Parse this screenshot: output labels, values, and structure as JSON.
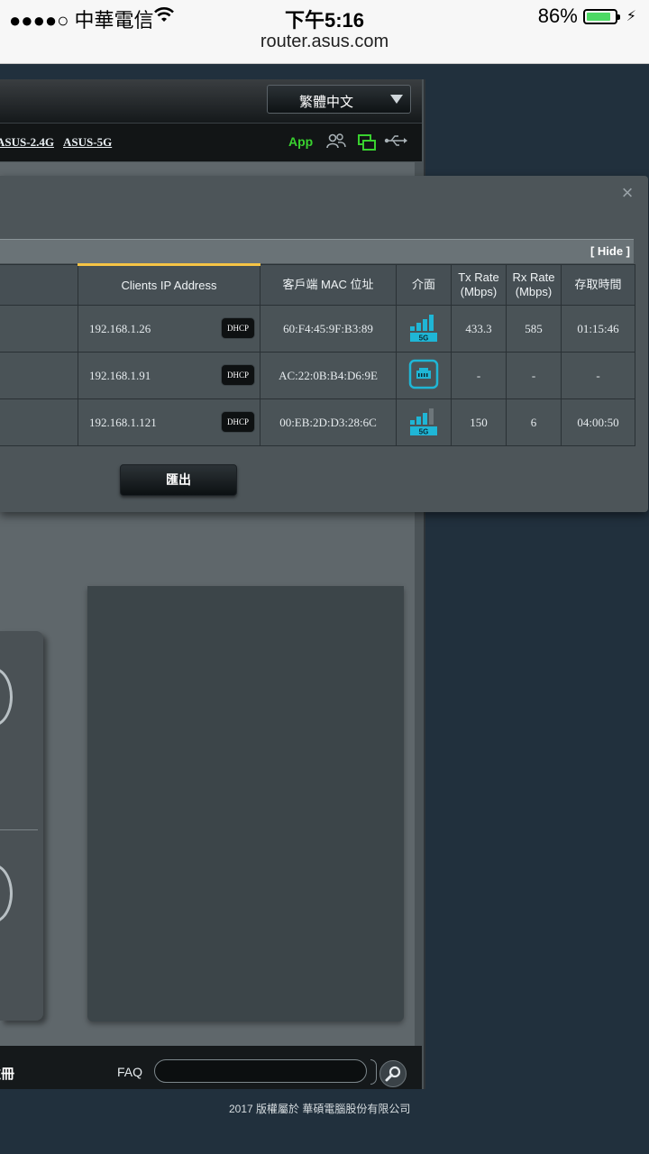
{
  "status_bar": {
    "carrier": "●●●●○ 中華電信",
    "time": "下午5:16",
    "battery": "86%",
    "battery_level": 0.86,
    "url": "router.asus.com"
  },
  "header": {
    "language": "繁體中文",
    "ssid_24": "ASUS-2.4G",
    "ssid_5": "ASUS-5G",
    "app_label": "App"
  },
  "modal": {
    "hide_link": "[ Hide ]",
    "columns": [
      "Clients IP Address",
      "客戶端 MAC 位址",
      "介面",
      "Tx Rate (Mbps)",
      "Rx Rate (Mbps)",
      "存取時間"
    ],
    "rows": [
      {
        "ip": "192.168.1.26",
        "ip_badge": "DHCP",
        "mac": "60:F4:45:9F:B3:89",
        "interface": "5G",
        "tx": "433.3",
        "rx": "585",
        "time": "01:15:46"
      },
      {
        "ip": "192.168.1.91",
        "ip_badge": "DHCP",
        "mac": "AC:22:0B:B4:D6:9E",
        "interface": "wired",
        "tx": "-",
        "rx": "-",
        "time": "-"
      },
      {
        "ip": "192.168.1.121",
        "ip_badge": "DHCP",
        "mac": "00:EB:2D:D3:28:6C",
        "interface": "5G",
        "tx": "150",
        "rx": "6",
        "time": "04:00:50"
      }
    ],
    "export_button": "匯出"
  },
  "footer": {
    "left_text": "註冊",
    "faq_label": "FAQ",
    "copyright": "2017 版權屬於 華碩電腦股份有限公司"
  },
  "colors": {
    "accent_cyan": "#1fb6d6",
    "app_green": "#39d12f",
    "active_column": "#f6c445"
  }
}
